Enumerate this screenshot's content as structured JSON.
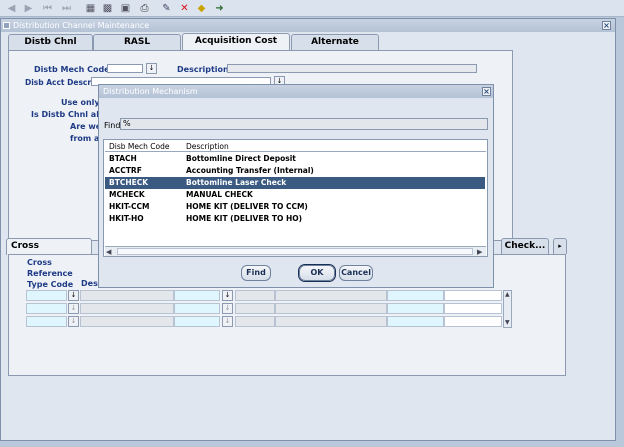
{
  "toolbar": {
    "icons": [
      "nav-first-icon",
      "nav-prev-icon",
      "nav-prev-block-icon",
      "nav-next-block-icon",
      "save-icon",
      "new-record-icon",
      "find-icon",
      "print-icon",
      "edit-icon",
      "delete-icon",
      "clear-icon",
      "exit-icon"
    ]
  },
  "window": {
    "title": "Distribution Channel Maintenance",
    "close": "×"
  },
  "tabs": [
    {
      "label": "Distb Chnl"
    },
    {
      "label": "RASL"
    },
    {
      "label": "Acquisition Cost Setup"
    },
    {
      "label": "Alternate Address"
    }
  ],
  "form": {
    "distb_mech_code_label": "Distb Mech Code:",
    "description_label": "Description:",
    "disb_acct_descr_label": "Disb Acct Descr:",
    "use_only_label": "Use only f",
    "is_distb_label": "Is Distb Chnl allov",
    "are_we_label": "Are we",
    "from_label": "from ac",
    "lov_glyph": "↓"
  },
  "cross_ref": {
    "tab_label": "Cross References",
    "check_label": "Check...",
    "more_glyph": "▸",
    "col_type_code": [
      "Cross",
      "Reference",
      "Type Code"
    ],
    "col_desc": "Desc"
  },
  "dialog": {
    "title": "Distribution Mechanism",
    "close": "×",
    "find_label": "Find",
    "find_value": "%",
    "col_code": "Disb Mech Code",
    "col_desc": "Description",
    "rows": [
      {
        "code": "BTACH",
        "desc": "Bottomline Direct Deposit",
        "selected": false
      },
      {
        "code": "ACCTRF",
        "desc": "Accounting Transfer (Internal)",
        "selected": false
      },
      {
        "code": "BTCHECK",
        "desc": "Bottomline Laser Check",
        "selected": true
      },
      {
        "code": "MCHECK",
        "desc": "MANUAL CHECK",
        "selected": false
      },
      {
        "code": "HKIT-CCM",
        "desc": "HOME KIT (DELIVER TO CCM)",
        "selected": false
      },
      {
        "code": "HKIT-HO",
        "desc": "HOME KIT (DELIVER TO HO)",
        "selected": false
      }
    ],
    "find_button": "Find",
    "ok_button": "OK",
    "cancel_button": "Cancel"
  }
}
